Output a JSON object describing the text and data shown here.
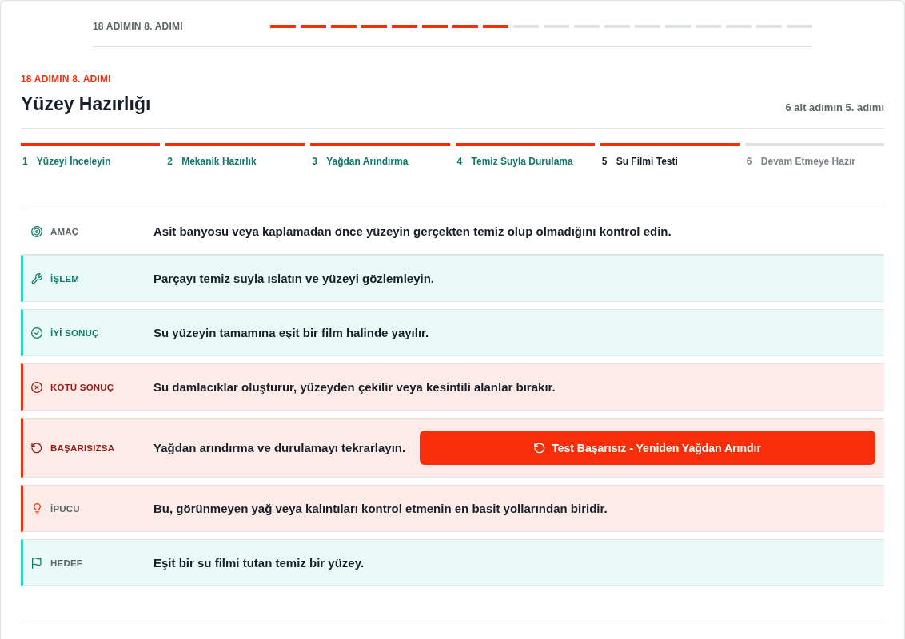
{
  "top_progress": {
    "label": "18 ADIMIN 8. ADIMI",
    "segments": [
      {
        "filled": true
      },
      {
        "filled": true
      },
      {
        "filled": true
      },
      {
        "filled": true
      },
      {
        "filled": true
      },
      {
        "filled": true
      },
      {
        "filled": true
      },
      {
        "filled": true
      },
      {
        "filled": false
      },
      {
        "filled": false
      },
      {
        "filled": false
      },
      {
        "filled": false
      },
      {
        "filled": false
      },
      {
        "filled": false
      },
      {
        "filled": false
      },
      {
        "filled": false
      },
      {
        "filled": false
      },
      {
        "filled": false
      }
    ]
  },
  "header": {
    "eyebrow": "18 ADIMIN 8. ADIMI",
    "title": "Yüzey Hazırlığı",
    "substep_counter": "6 alt adımın 5. adımı"
  },
  "substeps": [
    {
      "number": "1",
      "label": "Yüzeyi İnceleyin",
      "completed": true,
      "selected": false
    },
    {
      "number": "2",
      "label": "Mekanik Hazırlık",
      "completed": true,
      "selected": false
    },
    {
      "number": "3",
      "label": "Yağdan Arındırma",
      "completed": true,
      "selected": false
    },
    {
      "number": "4",
      "label": "Temiz Suyla Durulama",
      "completed": true,
      "selected": false
    },
    {
      "number": "5",
      "label": "Su Filmi Testi",
      "completed": true,
      "selected": true
    },
    {
      "number": "6",
      "label": "Devam Etmeye Hazır",
      "completed": false,
      "selected": false
    }
  ],
  "rows": [
    {
      "kind": "purpose",
      "label": "AMAÇ",
      "text": "Asit banyosu veya kaplamadan önce yüzeyin gerçekten temiz olup olmadığını kontrol edin."
    },
    {
      "kind": "action",
      "label": "İŞLEM",
      "text": "Parçayı temiz suyla ıslatın ve yüzeyi gözlemleyin."
    },
    {
      "kind": "good",
      "label": "İYİ SONUÇ",
      "text": "Su yüzeyin tamamına eşit bir film halinde yayılır."
    },
    {
      "kind": "bad",
      "label": "KÖTÜ SONUÇ",
      "text": "Su damlacıklar oluşturur, yüzeyden çekilir veya kesintili alanlar bırakır."
    },
    {
      "kind": "failure",
      "label": "BAŞARISIZSA",
      "text": "Yağdan arındırma ve durulamayı tekrarlayın.",
      "button": {
        "label": "Test Başarısız - Yeniden Yağdan Arındır"
      }
    },
    {
      "kind": "tip",
      "label": "İPUCU",
      "text": "Bu, görünmeyen yağ veya kalıntıları kontrol etmenin en basit yollarından biridir."
    },
    {
      "kind": "goal",
      "label": "HEDEF",
      "text": "Eşit bir su filmi tutan temiz bir yüzey."
    }
  ]
}
